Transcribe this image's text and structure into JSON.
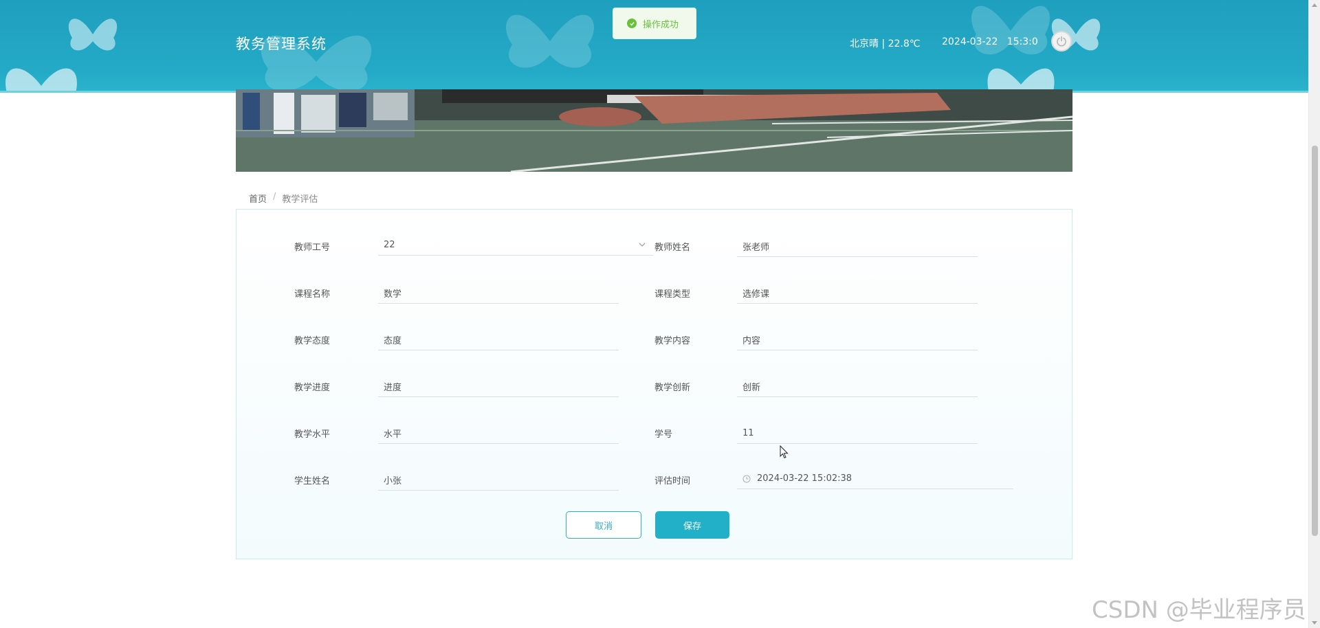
{
  "header": {
    "title": "教务管理系统",
    "weather": "北京晴 | 22.8℃",
    "date": "2024-03-22",
    "time": "15:3:0"
  },
  "toast": {
    "message": "操作成功"
  },
  "breadcrumb": {
    "home": "首页",
    "separator": "/",
    "current": "教学评估"
  },
  "form": {
    "teacher_id": {
      "label": "教师工号",
      "value": "22"
    },
    "teacher_name": {
      "label": "教师姓名",
      "value": "张老师"
    },
    "course_name": {
      "label": "课程名称",
      "value": "数学"
    },
    "course_type": {
      "label": "课程类型",
      "value": "选修课"
    },
    "attitude": {
      "label": "教学态度",
      "value": "态度"
    },
    "content": {
      "label": "教学内容",
      "value": "内容"
    },
    "progress": {
      "label": "教学进度",
      "value": "进度"
    },
    "innovation": {
      "label": "教学创新",
      "value": "创新"
    },
    "level": {
      "label": "教学水平",
      "value": "水平"
    },
    "student_id": {
      "label": "学号",
      "value": "11"
    },
    "student_name": {
      "label": "学生姓名",
      "value": "小张"
    },
    "eval_time": {
      "label": "评估时间",
      "value": "2024-03-22 15:02:38"
    }
  },
  "buttons": {
    "cancel": "取消",
    "save": "保存"
  },
  "watermark": "CSDN @毕业程序员",
  "colors": {
    "header": "#24aac6",
    "accent": "#22b0c9",
    "success": "#67c23a"
  },
  "icons": {
    "power": "power-icon",
    "success": "check-circle-icon",
    "dropdown": "chevron-down-icon",
    "time": "clock-icon"
  }
}
